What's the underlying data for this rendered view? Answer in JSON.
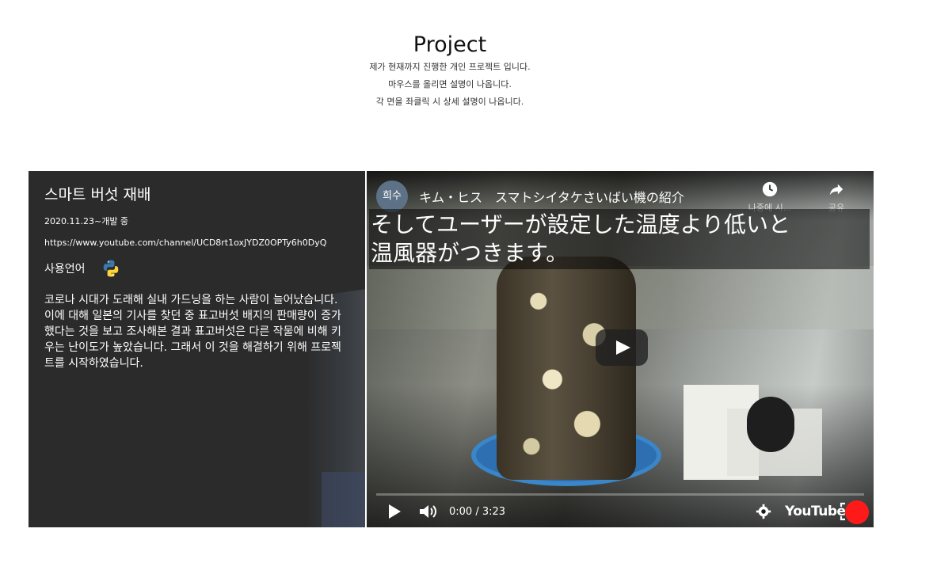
{
  "header": {
    "title": "Project",
    "lines": [
      "제가 현재까지 진행한 개인 프로젝트 입니다.",
      "마우스를 올리면 설명이 나옵니다.",
      "각 면을 좌클릭 시 상세 설명이 나옵니다."
    ]
  },
  "card": {
    "title": "스마트 버섯 재배",
    "date": "2020.11.23~개발 중",
    "url": "https://www.youtube.com/channel/UCD8rt1oxJYDZ0OPTy6h0DyQ",
    "language_label": "사용언어",
    "language_icon": "python-icon",
    "description": "코로나 시대가 도래해 실내 가드닝을 하는 사람이 늘어났습니다. 이에 대해 일본의 기사를 찾던 중 표고버섯 배지의 판매량이 증가했다는 것을 보고 조사해본 결과 표고버섯은 다른 작물에 비해 키우는 난이도가 높았습니다. 그래서 이 것을 해결하기 위해 프로젝트를 시작하였습니다."
  },
  "video": {
    "channel_avatar_text": "희수",
    "title": "キム・ヒス　スマトシイタケさいばい機の紹介",
    "watch_later_label": "나중에 시...",
    "share_label": "공유",
    "caption_lines": [
      "そしてユーザーが設定した温度より低いと",
      "温風器がつきます。"
    ],
    "time": "0:00 / 3:23",
    "progress": 0,
    "brand": "YouTube"
  },
  "colors": {
    "card_bg": "#2b2b2b",
    "accent_red": "#ff1a1a"
  }
}
